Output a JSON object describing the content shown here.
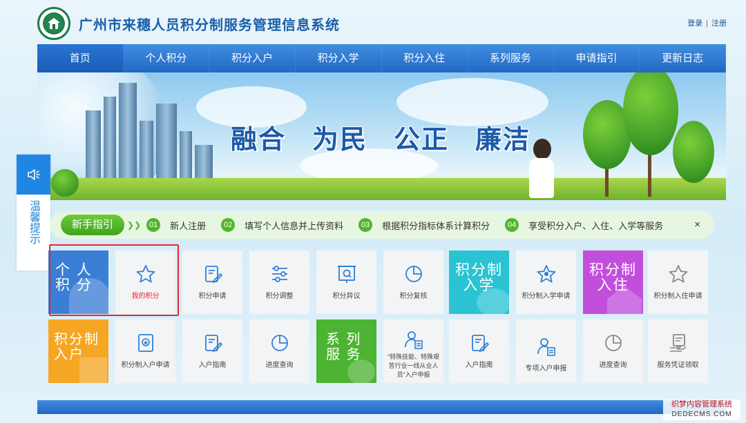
{
  "header": {
    "title": "广州市来穗人员积分制服务管理信息系统",
    "login": "登录",
    "separator": "|",
    "register": "注册"
  },
  "nav": {
    "items": [
      "首页",
      "个人积分",
      "积分入户",
      "积分入学",
      "积分入住",
      "系列服务",
      "申请指引",
      "更新日志"
    ],
    "active_index": 0
  },
  "banner": {
    "slogan": [
      "融合",
      "为民",
      "公正",
      "廉洁"
    ]
  },
  "tip": {
    "label": "温馨提示",
    "icon": "speaker-icon"
  },
  "guide": {
    "title": "新手指引",
    "steps": [
      {
        "num": "01",
        "label": "新人注册"
      },
      {
        "num": "02",
        "label": "填写个人信息并上传资料"
      },
      {
        "num": "03",
        "label": "根据积分指标体系计算积分"
      },
      {
        "num": "04",
        "label": "享受积分入户、入住、入学等服务"
      }
    ],
    "close": "×"
  },
  "tiles": {
    "row1": {
      "feature_personal": "个 人\n积 分",
      "my_points": "我的积分",
      "apply": "积分申请",
      "adjust": "积分调整",
      "objection": "积分异议",
      "review": "积分复核",
      "feature_school": "积分制\n入学",
      "school_apply": "积分制入学申请",
      "feature_housing": "积分制\n入住",
      "housing_apply": "积分制入住申请"
    },
    "row2": {
      "feature_hukou": "积分制\n入户",
      "hukou_apply": "积分制入户申请",
      "hukou_guide": "入户指南",
      "progress": "进度查询",
      "feature_series": "系 列\n服 务",
      "special_workers": "“特殊技能、特殊艰苦行业一线从业人员”入户申报",
      "guide2": "入户指南",
      "special_apply": "专项入户申报",
      "progress2": "进度查询",
      "certificate": "服务凭证领取"
    }
  },
  "colors": {
    "primary": "#2369c4",
    "personal": "#3a7fd5",
    "school": "#29c3d4",
    "housing": "#c24fdc",
    "hukou": "#f5a623",
    "series": "#4db332",
    "highlight": "#e8262f"
  },
  "watermark": {
    "line1": "织梦内容管理系统",
    "line2": "DEDECMS.COM"
  }
}
